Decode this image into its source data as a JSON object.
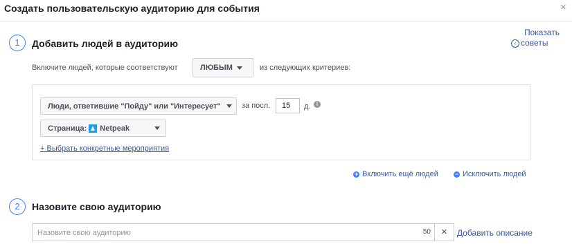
{
  "dialog": {
    "title": "Создать пользовательскую аудиторию для события",
    "close_symbol": "×"
  },
  "tips": {
    "line1": "Показать",
    "line2": "советы",
    "icon": "chevron-left-circle-icon"
  },
  "step1": {
    "number": "1",
    "title": "Добавить людей в аудиторию",
    "include_prefix": "Включите людей, которые соответствуют",
    "match_value": "ЛЮБЫМ",
    "include_suffix": "из следующих критериев:"
  },
  "criteria": {
    "rule_label": "Люди, ответившие \"Пойду\" или \"Интересует\"",
    "period_prefix": "за посл.",
    "days_value": "15",
    "days_unit": "д.",
    "info_symbol": "i",
    "page_prefix": "Страница:",
    "page_name": "Netpeak",
    "select_events_link": "+ Выбрать конкретные мероприятия"
  },
  "actions": {
    "include_more": "Включить ещё людей",
    "exclude": "Исключить людей"
  },
  "step2": {
    "number": "2",
    "title": "Назовите свою аудиторию",
    "input_placeholder": "Назовите свою аудиторию",
    "input_value": "",
    "char_counter": "50",
    "clear_symbol": "×",
    "add_description": "Добавить описание"
  },
  "colors": {
    "accent": "#4080ff",
    "link": "#365899",
    "border": "#dddfe2"
  }
}
